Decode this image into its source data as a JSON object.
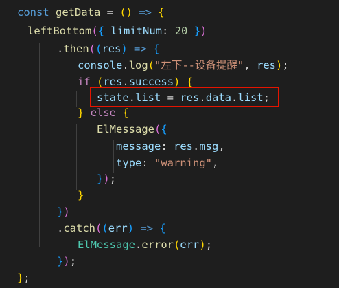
{
  "editor": {
    "theme": {
      "background": "#1e1e1e",
      "highlight_box": "#e51400"
    },
    "lines": [
      [
        {
          "t": "const ",
          "c": "kw"
        },
        {
          "t": "getData",
          "c": "fn"
        },
        {
          "t": " = ",
          "c": "op"
        },
        {
          "t": "()",
          "c": "p1"
        },
        {
          "t": " ",
          "c": "op"
        },
        {
          "t": "=>",
          "c": "kw"
        },
        {
          "t": " ",
          "c": "op"
        },
        {
          "t": "{",
          "c": "p1"
        }
      ],
      [
        {
          "t": "leftBottom",
          "c": "fn"
        },
        {
          "t": "(",
          "c": "p2"
        },
        {
          "t": "{",
          "c": "p3"
        },
        {
          "t": " ",
          "c": "op"
        },
        {
          "t": "limitNum",
          "c": "var"
        },
        {
          "t": ": ",
          "c": "op"
        },
        {
          "t": "20",
          "c": "num"
        },
        {
          "t": " ",
          "c": "op"
        },
        {
          "t": "}",
          "c": "p3"
        },
        {
          "t": ")",
          "c": "p2"
        }
      ],
      [
        {
          "t": ".",
          "c": "op"
        },
        {
          "t": "then",
          "c": "fn"
        },
        {
          "t": "(",
          "c": "p2"
        },
        {
          "t": "(",
          "c": "p3"
        },
        {
          "t": "res",
          "c": "var"
        },
        {
          "t": ")",
          "c": "p3"
        },
        {
          "t": " ",
          "c": "op"
        },
        {
          "t": "=>",
          "c": "kw"
        },
        {
          "t": " ",
          "c": "op"
        },
        {
          "t": "{",
          "c": "p3"
        }
      ],
      [
        {
          "t": "console",
          "c": "var"
        },
        {
          "t": ".",
          "c": "op"
        },
        {
          "t": "log",
          "c": "fn"
        },
        {
          "t": "(",
          "c": "p1"
        },
        {
          "t": "\"左下--设备提醒\"",
          "c": "str"
        },
        {
          "t": ", ",
          "c": "op"
        },
        {
          "t": "res",
          "c": "var"
        },
        {
          "t": ")",
          "c": "p1"
        },
        {
          "t": ";",
          "c": "op"
        }
      ],
      [
        {
          "t": "if",
          "c": "ctrl"
        },
        {
          "t": " ",
          "c": "op"
        },
        {
          "t": "(",
          "c": "p1"
        },
        {
          "t": "res",
          "c": "var"
        },
        {
          "t": ".",
          "c": "op"
        },
        {
          "t": "success",
          "c": "var"
        },
        {
          "t": ")",
          "c": "p1"
        },
        {
          "t": " ",
          "c": "op"
        },
        {
          "t": "{",
          "c": "p1"
        }
      ],
      [
        {
          "t": "state",
          "c": "var"
        },
        {
          "t": ".",
          "c": "op"
        },
        {
          "t": "list",
          "c": "var"
        },
        {
          "t": " = ",
          "c": "op"
        },
        {
          "t": "res",
          "c": "var"
        },
        {
          "t": ".",
          "c": "op"
        },
        {
          "t": "data",
          "c": "var"
        },
        {
          "t": ".",
          "c": "op"
        },
        {
          "t": "list",
          "c": "var"
        },
        {
          "t": ";",
          "c": "op"
        }
      ],
      [
        {
          "t": "}",
          "c": "p1"
        },
        {
          "t": " ",
          "c": "op"
        },
        {
          "t": "else",
          "c": "ctrl"
        },
        {
          "t": " ",
          "c": "op"
        },
        {
          "t": "{",
          "c": "p1"
        }
      ],
      [
        {
          "t": "ElMessage",
          "c": "fn"
        },
        {
          "t": "(",
          "c": "p2"
        },
        {
          "t": "{",
          "c": "p3"
        }
      ],
      [
        {
          "t": "message",
          "c": "var"
        },
        {
          "t": ": ",
          "c": "op"
        },
        {
          "t": "res",
          "c": "var"
        },
        {
          "t": ".",
          "c": "op"
        },
        {
          "t": "msg",
          "c": "var"
        },
        {
          "t": ",",
          "c": "op"
        }
      ],
      [
        {
          "t": "type",
          "c": "var"
        },
        {
          "t": ": ",
          "c": "op"
        },
        {
          "t": "\"warning\"",
          "c": "str"
        },
        {
          "t": ",",
          "c": "op"
        }
      ],
      [
        {
          "t": "}",
          "c": "p3"
        },
        {
          "t": ")",
          "c": "p2"
        },
        {
          "t": ";",
          "c": "op"
        }
      ],
      [
        {
          "t": "}",
          "c": "p1"
        }
      ],
      [
        {
          "t": "}",
          "c": "p3"
        },
        {
          "t": ")",
          "c": "p2"
        }
      ],
      [
        {
          "t": ".",
          "c": "op"
        },
        {
          "t": "catch",
          "c": "fn"
        },
        {
          "t": "(",
          "c": "p2"
        },
        {
          "t": "(",
          "c": "p3"
        },
        {
          "t": "err",
          "c": "var"
        },
        {
          "t": ")",
          "c": "p3"
        },
        {
          "t": " ",
          "c": "op"
        },
        {
          "t": "=>",
          "c": "kw"
        },
        {
          "t": " ",
          "c": "op"
        },
        {
          "t": "{",
          "c": "p3"
        }
      ],
      [
        {
          "t": "ElMessage",
          "c": "type"
        },
        {
          "t": ".",
          "c": "op"
        },
        {
          "t": "error",
          "c": "fn"
        },
        {
          "t": "(",
          "c": "p1"
        },
        {
          "t": "err",
          "c": "var"
        },
        {
          "t": ")",
          "c": "p1"
        },
        {
          "t": ";",
          "c": "op"
        }
      ],
      [
        {
          "t": "}",
          "c": "p3"
        },
        {
          "t": ")",
          "c": "p2"
        },
        {
          "t": ";",
          "c": "op"
        }
      ],
      [
        {
          "t": "}",
          "c": "p1"
        },
        {
          "t": ";",
          "c": "op"
        }
      ]
    ]
  }
}
